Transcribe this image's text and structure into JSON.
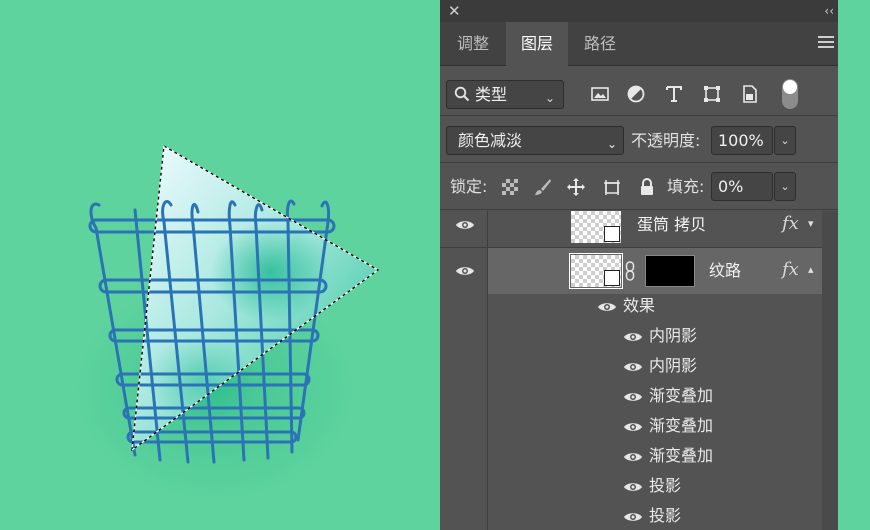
{
  "panel": {
    "tabs": [
      {
        "label": "调整",
        "active": false
      },
      {
        "label": "图层",
        "active": true
      },
      {
        "label": "路径",
        "active": false
      }
    ],
    "filter": {
      "kind_label": "类型"
    },
    "blend": {
      "mode": "颜色减淡",
      "opacity_label": "不透明度:",
      "opacity_value": "100%"
    },
    "lock": {
      "lock_label": "锁定:",
      "fill_label": "填充:",
      "fill_value": "0%"
    },
    "layers": [
      {
        "name": "蛋筒 拷贝",
        "has_fx": true,
        "fx_label": "fx",
        "selected": false
      },
      {
        "name": "纹路",
        "has_fx": true,
        "fx_label": "fx",
        "selected": true,
        "has_mask": true
      }
    ],
    "effects_header": "效果",
    "effects": [
      "内阴影",
      "内阴影",
      "渐变叠加",
      "渐变叠加",
      "渐变叠加",
      "投影",
      "投影"
    ]
  },
  "colors": {
    "background": "#5ed39e",
    "panel": "#535353",
    "selected_row": "#666666",
    "grid_stroke": "#2a73b4"
  },
  "icons": {
    "filter": [
      "image-filter-icon",
      "adjustment-filter-icon",
      "type-filter-icon",
      "shape-filter-icon",
      "smart-object-filter-icon"
    ],
    "lock": [
      "lock-transparent-icon",
      "lock-image-icon",
      "lock-position-icon",
      "lock-artboard-icon",
      "lock-all-icon"
    ]
  }
}
